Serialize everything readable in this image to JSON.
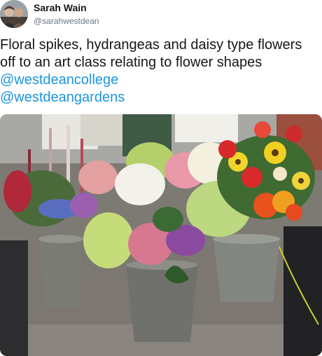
{
  "author": {
    "name": "Sarah Wain",
    "handle": "@sarahwestdean"
  },
  "tweet": {
    "text": "Floral spikes, hydrangeas and daisy type flowers off to an art class relating to flower shapes ",
    "mention_1": "@westdeancollege",
    "mention_2": "@westdeangardens"
  },
  "colors": {
    "mention": "#1b95e0",
    "handle": "#657786",
    "text": "#14171a"
  },
  "icons": {
    "avatar": "profile-photo"
  }
}
